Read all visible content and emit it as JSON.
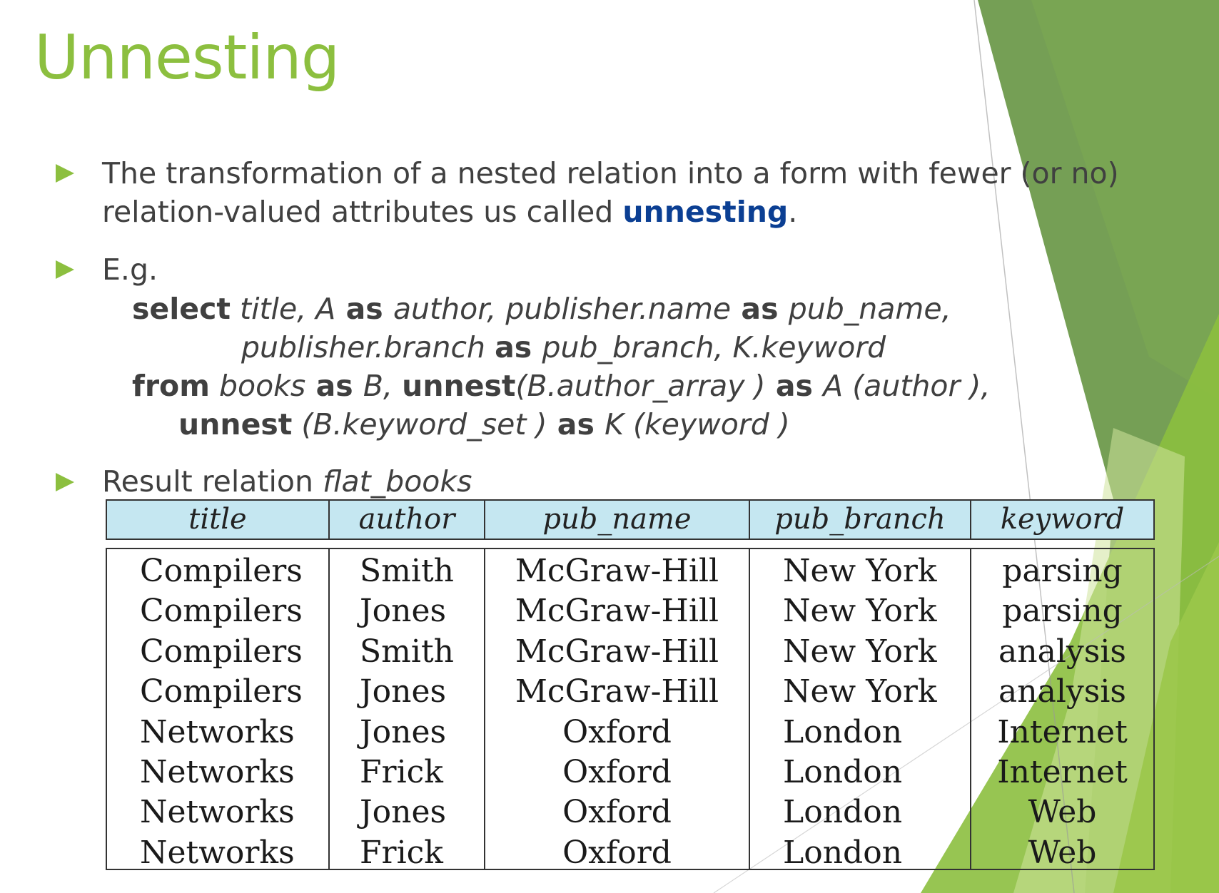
{
  "slide": {
    "title": "Unnesting",
    "bullet1": {
      "line1": "The transformation of a nested relation into a form with fewer (or no)",
      "line2_prefix": "relation-valued attributes us called ",
      "line2_keyword": "unnesting",
      "line2_suffix": "."
    },
    "bullet2": {
      "label": "E.g.",
      "code": {
        "select_kw": "select",
        "select_title": " title, ",
        "select_A": "A",
        "as1": " as ",
        "select_author": "author, publisher.name",
        "as2": " as ",
        "select_pubname": "pub_name,",
        "line2_branch": "publisher.branch ",
        "as3": " as ",
        "line2_rest": "pub_branch, K.keyword",
        "from_kw": "from",
        "from_books": " books",
        "as4": " as ",
        "from_B": "B, ",
        "unnest1": "unnest",
        "from_arr": "(B.author_array )",
        "as5": " as ",
        "from_A": "A (author ),",
        "unnest2": "unnest",
        "line4_set": " (B.keyword_set )",
        "as6": " as ",
        "line4_K": "K (keyword )"
      }
    },
    "bullet3": {
      "label_prefix": "Result relation ",
      "label_name": "flat_books"
    },
    "table": {
      "headers": [
        "title",
        "author",
        "pub_name",
        "pub_branch",
        "keyword"
      ],
      "columns": [
        [
          "Compilers",
          "Compilers",
          "Compilers",
          "Compilers",
          "Networks",
          "Networks",
          "Networks",
          "Networks"
        ],
        [
          "Smith",
          "Jones",
          "Smith",
          "Jones",
          "Jones",
          "Frick",
          "Jones",
          "Frick"
        ],
        [
          "McGraw-Hill",
          "McGraw-Hill",
          "McGraw-Hill",
          "McGraw-Hill",
          "Oxford",
          "Oxford",
          "Oxford",
          "Oxford"
        ],
        [
          "New York",
          "New York",
          "New York",
          "New York",
          "London",
          "London",
          "London",
          "London"
        ],
        [
          "parsing",
          "parsing",
          "analysis",
          "analysis",
          "Internet",
          "Internet",
          "Web",
          "Web"
        ]
      ]
    },
    "colors": {
      "accent_green": "#8cbf3f",
      "keyword_blue": "#0b3f93",
      "header_fill": "#c5e7f1"
    }
  }
}
